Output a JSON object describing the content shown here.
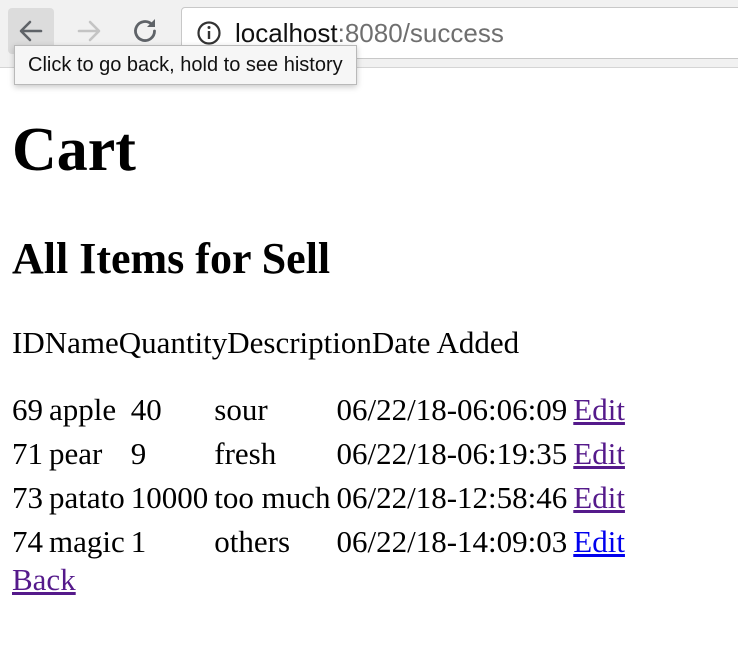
{
  "browser": {
    "url_host": "localhost",
    "url_rest": ":8080/success",
    "tooltip": "Click to go back, hold to see history",
    "icons": {
      "back": "arrow-left-icon",
      "forward": "arrow-right-icon",
      "reload": "reload-icon",
      "info": "info-icon"
    }
  },
  "page": {
    "title": "Cart",
    "subtitle": "All Items for Sell",
    "columns": [
      "ID",
      "Name",
      "Quantity",
      "Description",
      "Date Added"
    ],
    "rows": [
      {
        "id": "69",
        "name": "apple",
        "quantity": "40",
        "description": "sour",
        "date": "06/22/18-06:06:09",
        "edit": "Edit",
        "visited": true
      },
      {
        "id": "71",
        "name": "pear",
        "quantity": "9",
        "description": "fresh",
        "date": "06/22/18-06:19:35",
        "edit": "Edit",
        "visited": true
      },
      {
        "id": "73",
        "name": "patato",
        "quantity": "10000",
        "description": "too much",
        "date": "06/22/18-12:58:46",
        "edit": "Edit",
        "visited": true
      },
      {
        "id": "74",
        "name": "magic",
        "quantity": "1",
        "description": "others",
        "date": "06/22/18-14:09:03",
        "edit": "Edit",
        "visited": false
      }
    ],
    "back_link": "Back"
  },
  "colors": {
    "visited_link": "#551a8b",
    "unvisited_link": "#0000ee"
  }
}
